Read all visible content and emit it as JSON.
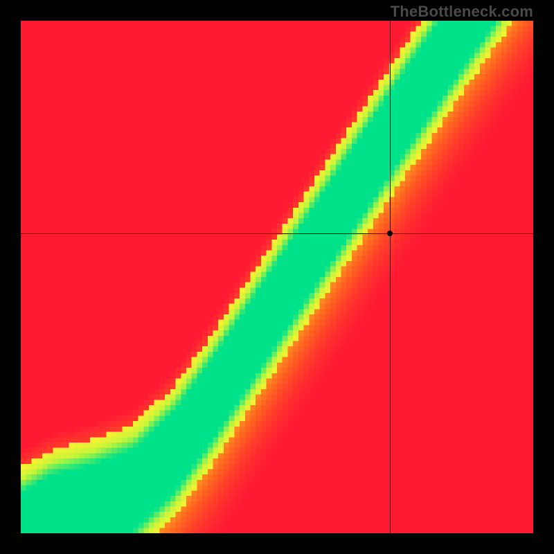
{
  "watermark": "TheBottleneck.com",
  "chart_data": {
    "type": "heatmap",
    "title": "",
    "xlabel": "",
    "ylabel": "",
    "xlim": [
      0,
      1
    ],
    "ylim": [
      0,
      1
    ],
    "grid_resolution": 96,
    "colormap": {
      "stops": [
        {
          "t": 0.0,
          "color": "#ff1a33"
        },
        {
          "t": 0.25,
          "color": "#ff6a1f"
        },
        {
          "t": 0.5,
          "color": "#ffd225"
        },
        {
          "t": 0.7,
          "color": "#fff030"
        },
        {
          "t": 0.85,
          "color": "#c7f53a"
        },
        {
          "t": 1.0,
          "color": "#00e28a"
        }
      ]
    },
    "ridge": {
      "description": "green optimal curve y(x): mild S-bend near origin then near-linear steep slope",
      "control_points": [
        {
          "x": 0.0,
          "y": 0.0
        },
        {
          "x": 0.06,
          "y": 0.035
        },
        {
          "x": 0.14,
          "y": 0.055
        },
        {
          "x": 0.22,
          "y": 0.085
        },
        {
          "x": 0.3,
          "y": 0.16
        },
        {
          "x": 0.38,
          "y": 0.27
        },
        {
          "x": 0.48,
          "y": 0.42
        },
        {
          "x": 0.58,
          "y": 0.57
        },
        {
          "x": 0.72,
          "y": 0.78
        },
        {
          "x": 0.86,
          "y": 0.985
        },
        {
          "x": 1.0,
          "y": 1.18
        }
      ],
      "band_halfwidth_y": 0.035
    },
    "crosshair": {
      "x": 0.72,
      "y": 0.585
    },
    "marker": {
      "x": 0.72,
      "y": 0.585
    }
  }
}
